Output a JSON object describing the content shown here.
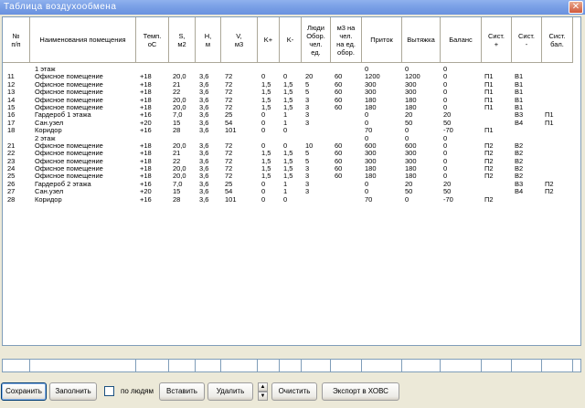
{
  "window": {
    "title": "Таблица воздухообмена",
    "close_glyph": "✕"
  },
  "columns": [
    "№\nп/п",
    "Наименования помещения",
    "Темп.\noC",
    "S,\nм2",
    "H,\nм",
    "V,\nм3",
    "K+",
    "K-",
    "Люди\nОбор.\nчел.\nед.",
    "м3 на\nчел.\nна ед.\nобор.",
    "Приток",
    "Вытяжка",
    "Баланс",
    "Сист.\n+",
    "Сист.\n-",
    "Сист.\nбал."
  ],
  "rows": [
    [
      "",
      "1 этаж",
      "",
      "",
      "",
      "",
      "",
      "",
      "",
      "",
      "0",
      "0",
      "0",
      "",
      "",
      ""
    ],
    [
      "11",
      "Офисное помещение",
      "+18",
      "20,0",
      "3,6",
      "72",
      "0",
      "0",
      "20",
      "60",
      "1200",
      "1200",
      "0",
      "П1",
      "В1",
      ""
    ],
    [
      "12",
      "Офисное помещение",
      "+18",
      "21",
      "3,6",
      "72",
      "1,5",
      "1,5",
      "5",
      "60",
      "300",
      "300",
      "0",
      "П1",
      "В1",
      ""
    ],
    [
      "13",
      "Офисное помещение",
      "+18",
      "22",
      "3,6",
      "72",
      "1,5",
      "1,5",
      "5",
      "60",
      "300",
      "300",
      "0",
      "П1",
      "В1",
      ""
    ],
    [
      "14",
      "Офисное помещение",
      "+18",
      "20,0",
      "3,6",
      "72",
      "1,5",
      "1,5",
      "3",
      "60",
      "180",
      "180",
      "0",
      "П1",
      "В1",
      ""
    ],
    [
      "15",
      "Офисное помещение",
      "+18",
      "20,0",
      "3,6",
      "72",
      "1,5",
      "1,5",
      "3",
      "60",
      "180",
      "180",
      "0",
      "П1",
      "В1",
      ""
    ],
    [
      "16",
      "Гардероб 1 этажа",
      "+16",
      "7,0",
      "3,6",
      "25",
      "0",
      "1",
      "3",
      "",
      "0",
      "20",
      "20",
      "",
      "В3",
      "П1"
    ],
    [
      "17",
      "Сан.узел",
      "+20",
      "15",
      "3,6",
      "54",
      "0",
      "1",
      "3",
      "",
      "0",
      "50",
      "50",
      "",
      "В4",
      "П1"
    ],
    [
      "18",
      "Коридор",
      "+16",
      "28",
      "3,6",
      "101",
      "0",
      "0",
      "",
      "",
      "70",
      "0",
      "-70",
      "П1",
      "",
      ""
    ],
    [
      "",
      "2 этаж",
      "",
      "",
      "",
      "",
      "",
      "",
      "",
      "",
      "0",
      "0",
      "0",
      "",
      "",
      ""
    ],
    [
      "21",
      "Офисное помещение",
      "+18",
      "20,0",
      "3,6",
      "72",
      "0",
      "0",
      "10",
      "60",
      "600",
      "600",
      "0",
      "П2",
      "В2",
      ""
    ],
    [
      "22",
      "Офисное помещение",
      "+18",
      "21",
      "3,6",
      "72",
      "1,5",
      "1,5",
      "5",
      "60",
      "300",
      "300",
      "0",
      "П2",
      "В2",
      ""
    ],
    [
      "23",
      "Офисное помещение",
      "+18",
      "22",
      "3,6",
      "72",
      "1,5",
      "1,5",
      "5",
      "60",
      "300",
      "300",
      "0",
      "П2",
      "В2",
      ""
    ],
    [
      "24",
      "Офисное помещение",
      "+18",
      "20,0",
      "3,6",
      "72",
      "1,5",
      "1,5",
      "3",
      "60",
      "180",
      "180",
      "0",
      "П2",
      "В2",
      ""
    ],
    [
      "25",
      "Офисное помещение",
      "+18",
      "20,0",
      "3,6",
      "72",
      "1,5",
      "1,5",
      "3",
      "60",
      "180",
      "180",
      "0",
      "П2",
      "В2",
      ""
    ],
    [
      "26",
      "Гардероб 2 этажа",
      "+16",
      "7,0",
      "3,6",
      "25",
      "0",
      "1",
      "3",
      "",
      "0",
      "20",
      "20",
      "",
      "В3",
      "П2"
    ],
    [
      "27",
      "Сан.узел",
      "+20",
      "15",
      "3,6",
      "54",
      "0",
      "1",
      "3",
      "",
      "0",
      "50",
      "50",
      "",
      "В4",
      "П2"
    ],
    [
      "28",
      "Коридор",
      "+16",
      "28",
      "3,6",
      "101",
      "0",
      "0",
      "",
      "",
      "70",
      "0",
      "-70",
      "П2",
      "",
      ""
    ]
  ],
  "toolbar": {
    "save": "Сохранить",
    "fill": "Заполнить",
    "by_people": "по людям",
    "insert": "Вставить",
    "delete": "Удалить",
    "spin_up": "▲",
    "spin_down": "▼",
    "clear": "Очистить",
    "export": "Экспорт в ХОВС"
  }
}
